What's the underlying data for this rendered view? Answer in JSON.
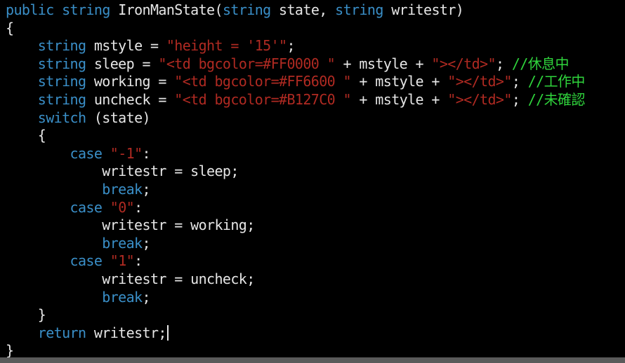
{
  "colors": {
    "background": "#000000",
    "keyword": "#3a8fc8",
    "string": "#b02a22",
    "comment": "#2fd43c",
    "text": "#e6e6e6"
  },
  "code": [
    [
      {
        "t": "kw",
        "v": "public"
      },
      {
        "t": "txt",
        "v": " "
      },
      {
        "t": "kw",
        "v": "string"
      },
      {
        "t": "txt",
        "v": " IronManState("
      },
      {
        "t": "kw",
        "v": "string"
      },
      {
        "t": "txt",
        "v": " state, "
      },
      {
        "t": "kw",
        "v": "string"
      },
      {
        "t": "txt",
        "v": " writestr)"
      }
    ],
    [
      {
        "t": "txt",
        "v": "{"
      }
    ],
    [
      {
        "t": "txt",
        "v": "    "
      },
      {
        "t": "kw",
        "v": "string"
      },
      {
        "t": "txt",
        "v": " mstyle = "
      },
      {
        "t": "str",
        "v": "\"height = '15'\""
      },
      {
        "t": "txt",
        "v": ";"
      }
    ],
    [
      {
        "t": "txt",
        "v": "    "
      },
      {
        "t": "kw",
        "v": "string"
      },
      {
        "t": "txt",
        "v": " sleep = "
      },
      {
        "t": "str",
        "v": "\"<td bgcolor=#FF0000 \""
      },
      {
        "t": "txt",
        "v": " + mstyle + "
      },
      {
        "t": "str",
        "v": "\"></td>\""
      },
      {
        "t": "txt",
        "v": "; "
      },
      {
        "t": "cmt",
        "v": "//休息中"
      }
    ],
    [
      {
        "t": "txt",
        "v": "    "
      },
      {
        "t": "kw",
        "v": "string"
      },
      {
        "t": "txt",
        "v": " working = "
      },
      {
        "t": "str",
        "v": "\"<td bgcolor=#FF6600 \""
      },
      {
        "t": "txt",
        "v": " + mstyle + "
      },
      {
        "t": "str",
        "v": "\"></td>\""
      },
      {
        "t": "txt",
        "v": "; "
      },
      {
        "t": "cmt",
        "v": "//工作中"
      }
    ],
    [
      {
        "t": "txt",
        "v": "    "
      },
      {
        "t": "kw",
        "v": "string"
      },
      {
        "t": "txt",
        "v": " uncheck = "
      },
      {
        "t": "str",
        "v": "\"<td bgcolor=#B127C0 \""
      },
      {
        "t": "txt",
        "v": " + mstyle + "
      },
      {
        "t": "str",
        "v": "\"></td>\""
      },
      {
        "t": "txt",
        "v": "; "
      },
      {
        "t": "cmt",
        "v": "//未確認"
      }
    ],
    [
      {
        "t": "txt",
        "v": "    "
      },
      {
        "t": "kw",
        "v": "switch"
      },
      {
        "t": "txt",
        "v": " (state)"
      }
    ],
    [
      {
        "t": "txt",
        "v": "    {"
      }
    ],
    [
      {
        "t": "txt",
        "v": "        "
      },
      {
        "t": "kw",
        "v": "case"
      },
      {
        "t": "txt",
        "v": " "
      },
      {
        "t": "str",
        "v": "\"-1\""
      },
      {
        "t": "txt",
        "v": ":"
      }
    ],
    [
      {
        "t": "txt",
        "v": "            writestr = sleep;"
      }
    ],
    [
      {
        "t": "txt",
        "v": "            "
      },
      {
        "t": "kw",
        "v": "break"
      },
      {
        "t": "txt",
        "v": ";"
      }
    ],
    [
      {
        "t": "txt",
        "v": "        "
      },
      {
        "t": "kw",
        "v": "case"
      },
      {
        "t": "txt",
        "v": " "
      },
      {
        "t": "str",
        "v": "\"0\""
      },
      {
        "t": "txt",
        "v": ":"
      }
    ],
    [
      {
        "t": "txt",
        "v": "            writestr = working;"
      }
    ],
    [
      {
        "t": "txt",
        "v": "            "
      },
      {
        "t": "kw",
        "v": "break"
      },
      {
        "t": "txt",
        "v": ";"
      }
    ],
    [
      {
        "t": "txt",
        "v": "        "
      },
      {
        "t": "kw",
        "v": "case"
      },
      {
        "t": "txt",
        "v": " "
      },
      {
        "t": "str",
        "v": "\"1\""
      },
      {
        "t": "txt",
        "v": ":"
      }
    ],
    [
      {
        "t": "txt",
        "v": "            writestr = uncheck;"
      }
    ],
    [
      {
        "t": "txt",
        "v": "            "
      },
      {
        "t": "kw",
        "v": "break"
      },
      {
        "t": "txt",
        "v": ";"
      }
    ],
    [
      {
        "t": "txt",
        "v": "    }"
      }
    ],
    [
      {
        "t": "txt",
        "v": "    "
      },
      {
        "t": "kw",
        "v": "return"
      },
      {
        "t": "txt",
        "v": " writestr;"
      },
      {
        "t": "caret",
        "v": ""
      }
    ],
    [
      {
        "t": "txt",
        "v": "}"
      }
    ]
  ]
}
